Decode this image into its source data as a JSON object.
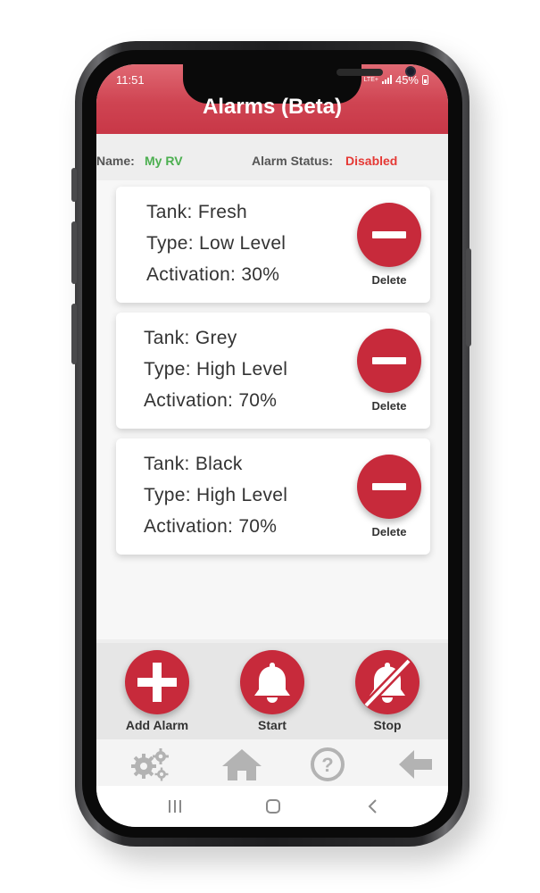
{
  "status_bar": {
    "time": "11:51",
    "network": "LTE+",
    "battery": "45%"
  },
  "header": {
    "title": "Alarms (Beta)"
  },
  "info": {
    "name_label": "Name:",
    "name_value": "My RV",
    "status_label": "Alarm Status:",
    "status_value": "Disabled"
  },
  "alarms": [
    {
      "tank": "Tank: Fresh",
      "type": "Type: Low Level",
      "activation": "Activation: 30%",
      "delete_label": "Delete"
    },
    {
      "tank": "Tank: Grey",
      "type": "Type: High Level",
      "activation": "Activation: 70%",
      "delete_label": "Delete"
    },
    {
      "tank": "Tank: Black",
      "type": "Type: High Level",
      "activation": "Activation: 70%",
      "delete_label": "Delete"
    }
  ],
  "actions": {
    "add_label": "Add Alarm",
    "start_label": "Start",
    "stop_label": "Stop"
  },
  "nav": {
    "items": [
      "settings-icon",
      "home-icon",
      "help-icon",
      "back-arrow-icon"
    ]
  },
  "colors": {
    "accent": "#c72a3b",
    "header": "#d04452",
    "ok_green": "#4caf50",
    "alert_red": "#e53935"
  }
}
